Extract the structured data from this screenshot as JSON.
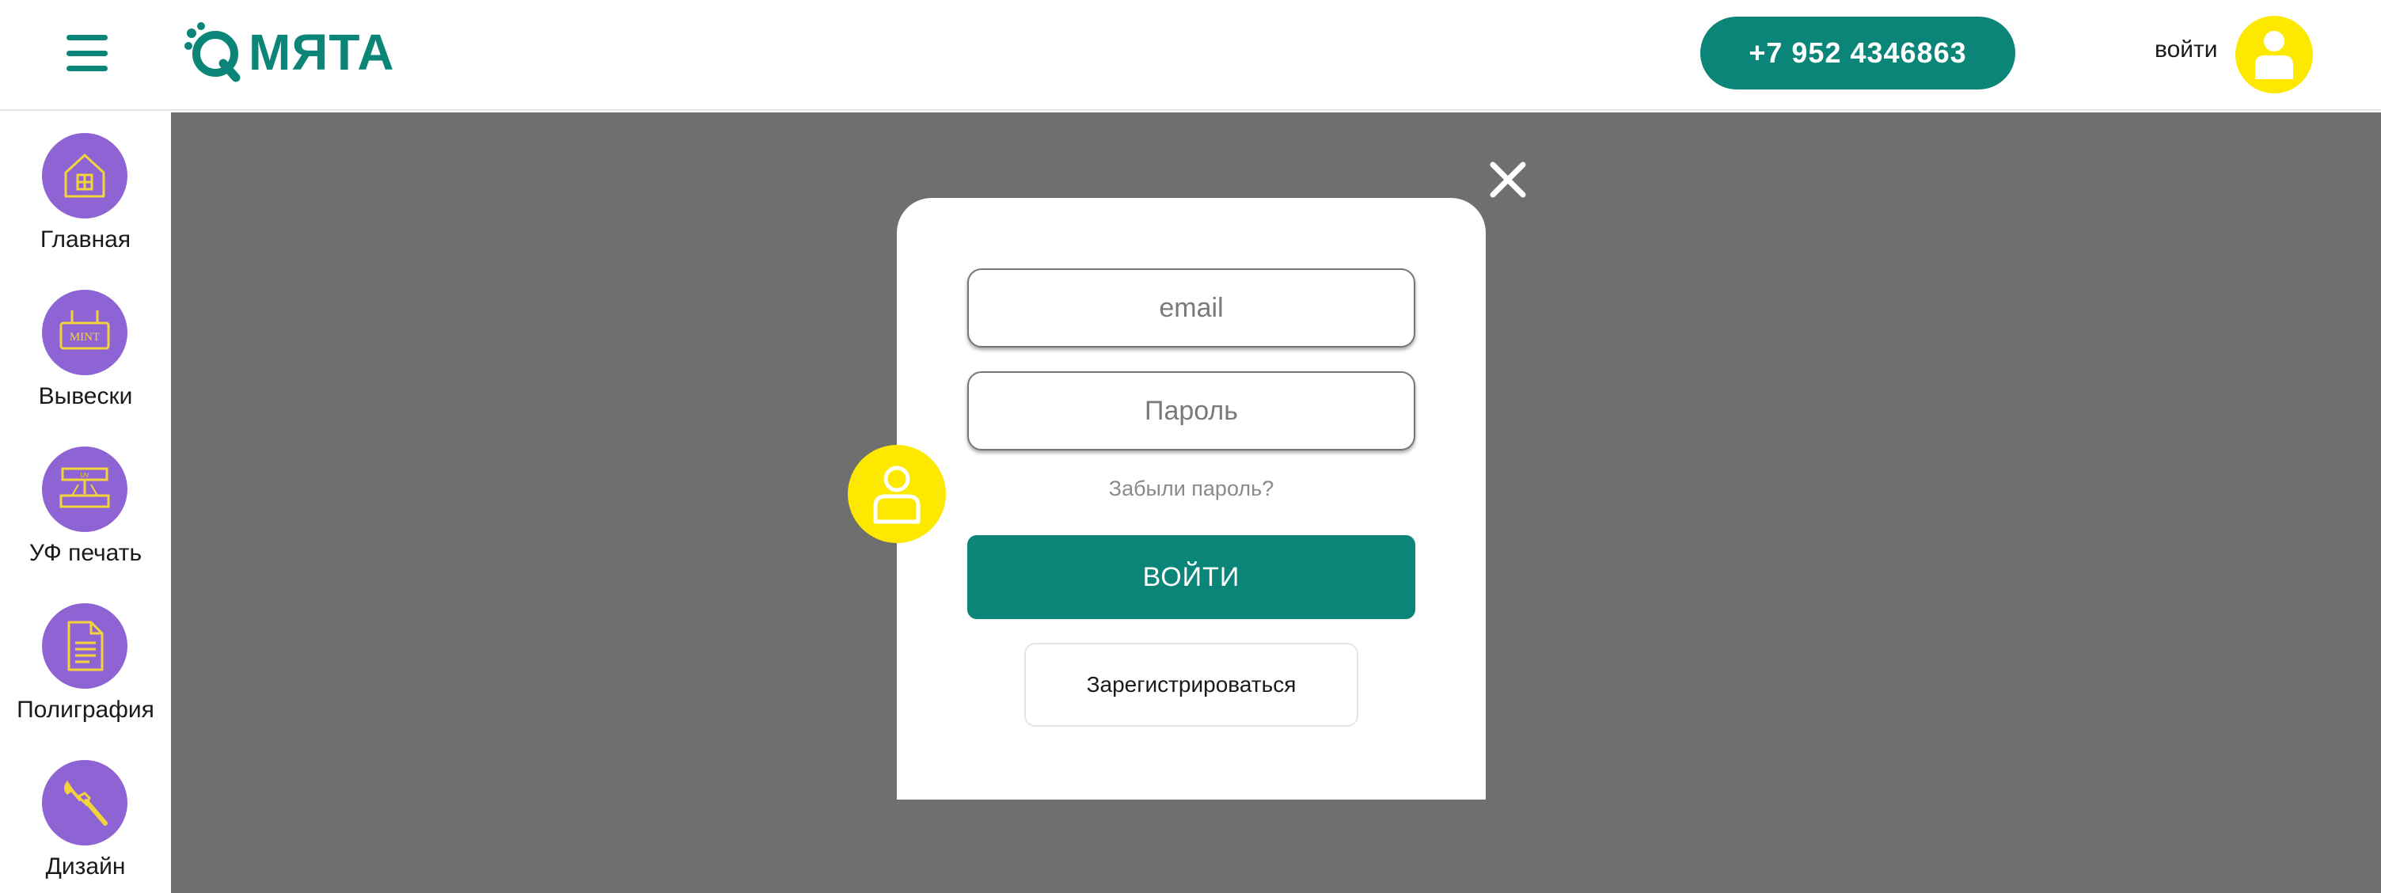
{
  "header": {
    "menu_icon": "hamburger-menu-icon",
    "logo_text": "МЯТА",
    "logo_icon": "q-logo-mark",
    "phone": "+7 952 4346863",
    "login_label": "войти",
    "avatar_icon": "user-icon"
  },
  "sidebar": {
    "items": [
      {
        "label": "Главная",
        "icon": "house-icon"
      },
      {
        "label": "Вывески",
        "icon": "signboard-icon",
        "icon_text": "MINT"
      },
      {
        "label": "УФ печать",
        "icon": "uv-printer-icon",
        "icon_text": "UV"
      },
      {
        "label": "Полиграфия",
        "icon": "document-icon"
      },
      {
        "label": "Дизайн",
        "icon": "paintbrush-icon"
      }
    ]
  },
  "modal": {
    "close_icon": "close-icon",
    "avatar_icon": "user-icon",
    "email_placeholder": "email",
    "password_placeholder": "Пароль",
    "forgot_label": "Забыли пароль?",
    "submit_label": "ВОЙТИ",
    "register_label": "Зарегистрироваться"
  },
  "colors": {
    "brand_green": "#0b8577",
    "nav_purple": "#8e63d3",
    "icon_yellow": "#fde800",
    "overlay_gray": "#6f6f6f"
  }
}
